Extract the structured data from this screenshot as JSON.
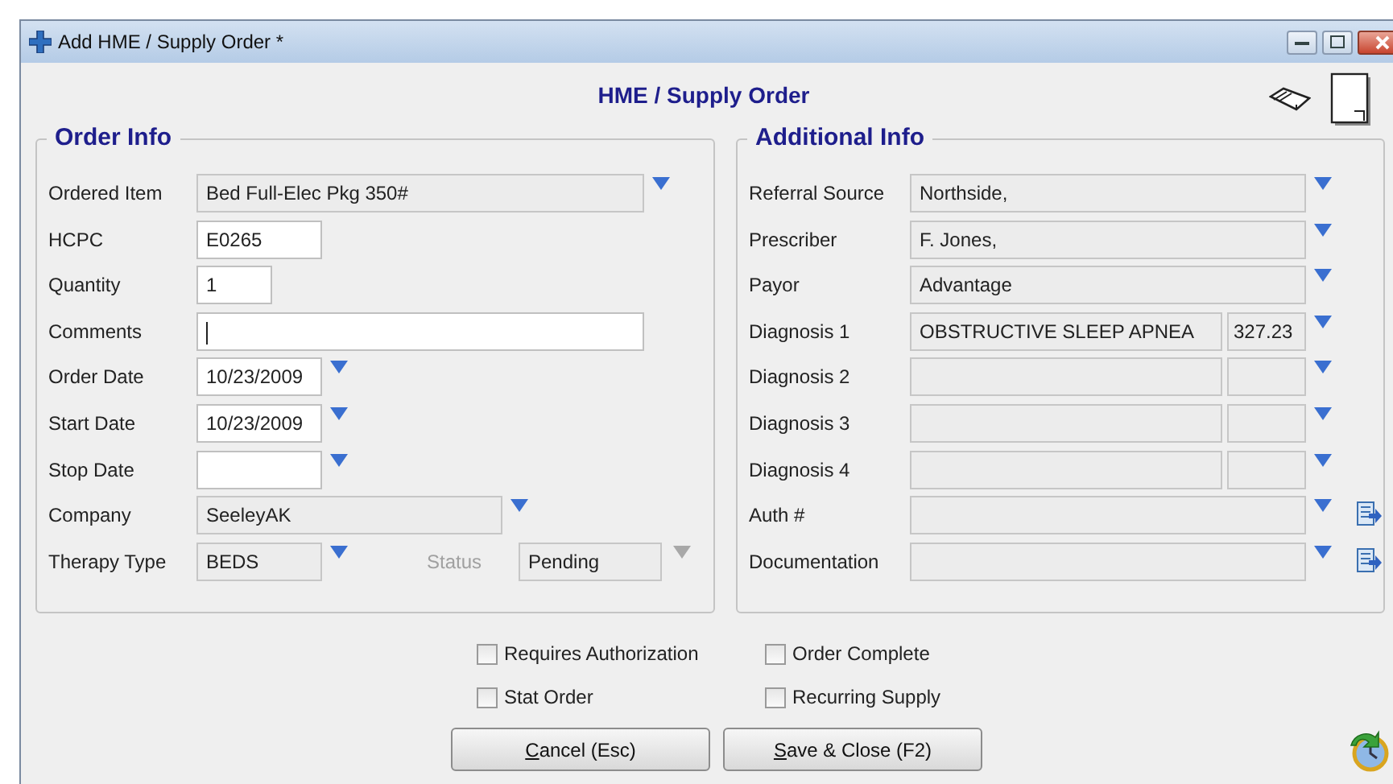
{
  "window": {
    "title": "Add HME / Supply Order *"
  },
  "heading": "HME / Supply Order",
  "order_info": {
    "title": "Order Info",
    "fields": [
      {
        "label": "Ordered Item",
        "value": "Bed Full-Elec Pkg 350#",
        "editable": false,
        "dropdown": true
      },
      {
        "label": "HCPC",
        "value": "E0265",
        "editable": true,
        "dropdown": false
      },
      {
        "label": "Quantity",
        "value": "1",
        "editable": true,
        "dropdown": false
      },
      {
        "label": "Comments",
        "editable": true,
        "dropdown": false,
        "focused": true
      },
      {
        "label": "Order Date",
        "value": "10/23/2009",
        "editable": true,
        "dropdown": true
      },
      {
        "label": "Start Date",
        "value": "10/23/2009",
        "editable": true,
        "dropdown": true
      },
      {
        "label": "Stop Date",
        "editable": true,
        "dropdown": true
      },
      {
        "label": "Company",
        "value": "SeeleyAK",
        "editable": false,
        "dropdown": true
      },
      {
        "label": "Therapy Type",
        "value": "BEDS",
        "editable": false,
        "dropdown": true
      }
    ],
    "status": {
      "label": "Status",
      "value": "Pending",
      "disabled": true
    }
  },
  "additional_info": {
    "title": "Additional Info",
    "fields": [
      {
        "kind": "text",
        "label": "Referral Source",
        "value": "Northside,",
        "attach": false
      },
      {
        "kind": "text",
        "label": "Prescriber",
        "value": "F. Jones,",
        "attach": false
      },
      {
        "kind": "text",
        "label": "Payor",
        "value": "Advantage",
        "attach": false
      },
      {
        "kind": "diagnosis",
        "label": "Diagnosis 1",
        "value": "OBSTRUCTIVE SLEEP APNEA",
        "code": "327.23",
        "attach": false
      },
      {
        "kind": "diagnosis",
        "label": "Diagnosis 2",
        "attach": false
      },
      {
        "kind": "diagnosis",
        "label": "Diagnosis 3",
        "attach": false
      },
      {
        "kind": "diagnosis",
        "label": "Diagnosis 4",
        "attach": false
      },
      {
        "kind": "text",
        "label": "Auth #",
        "attach": true
      },
      {
        "kind": "text",
        "label": "Documentation",
        "attach": true
      }
    ]
  },
  "checkboxes": [
    {
      "label": "Requires Authorization",
      "checked": false
    },
    {
      "label": "Order Complete",
      "checked": false
    },
    {
      "label": "Stat Order",
      "checked": false
    },
    {
      "label": "Recurring Supply",
      "checked": false
    }
  ],
  "buttons": [
    {
      "mnemonic": "C",
      "rest": "ancel (Esc)"
    },
    {
      "mnemonic": "S",
      "rest": "ave & Close (F2)"
    }
  ]
}
